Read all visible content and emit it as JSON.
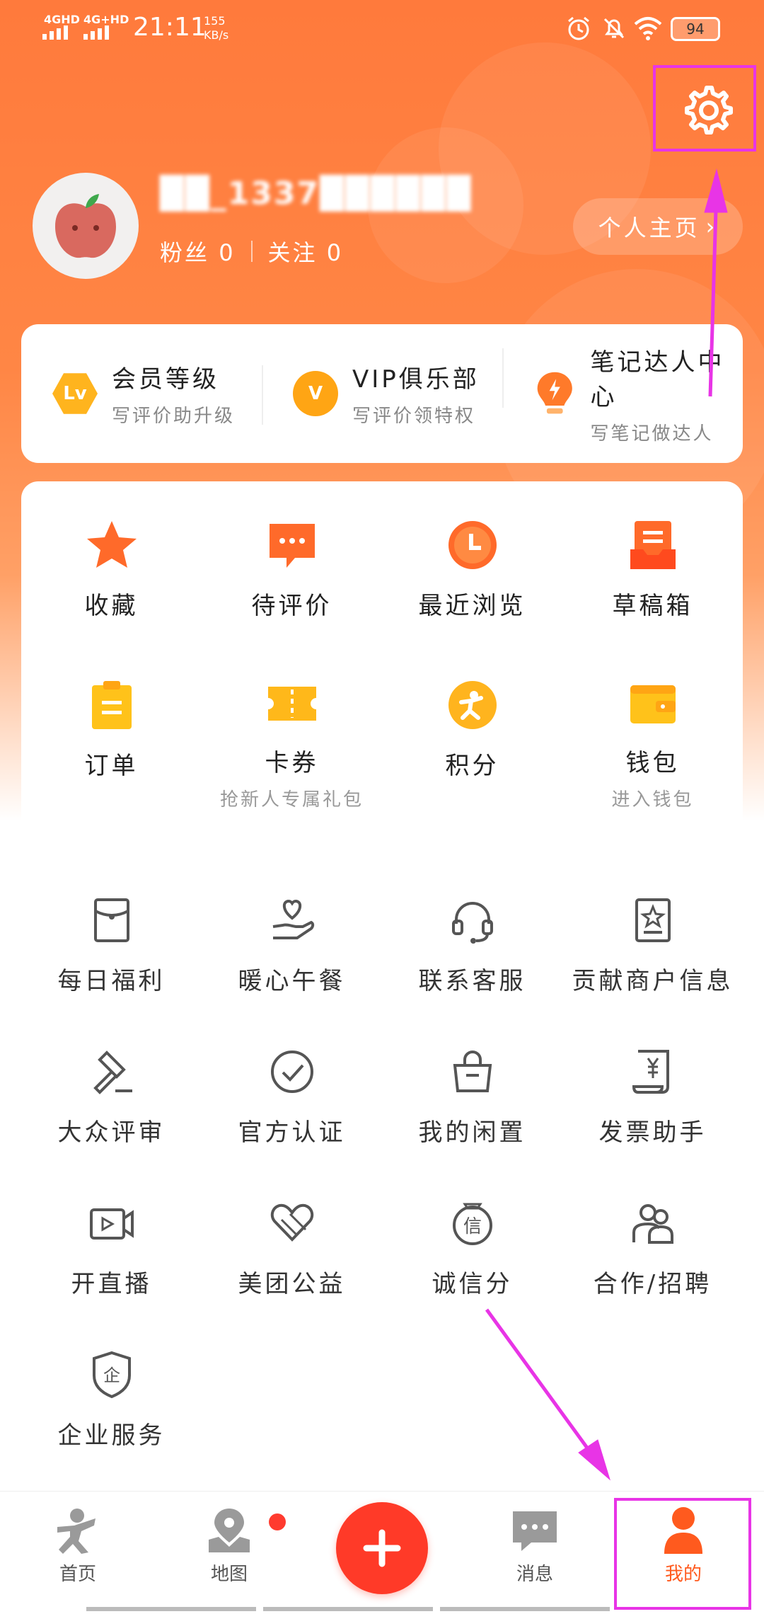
{
  "status_bar": {
    "network1": "4GHD",
    "network2": "4G+HD",
    "time": "21:11",
    "speed_value": "155",
    "speed_unit": "KB/s",
    "battery": "94"
  },
  "profile": {
    "username": "██_1337██████",
    "fans_label": "粉丝",
    "fans_count": "0",
    "follow_label": "关注",
    "follow_count": "0",
    "homepage_label": "个人主页"
  },
  "member": [
    {
      "badge": "Lv",
      "title": "会员等级",
      "subtitle": "写评价助升级"
    },
    {
      "badge": "V",
      "title": "VIP俱乐部",
      "subtitle": "写评价领特权"
    },
    {
      "badge": "",
      "title": "笔记达人中心",
      "subtitle": "写笔记做达人"
    }
  ],
  "quick": [
    {
      "icon": "star-icon",
      "label": "收藏",
      "sub": ""
    },
    {
      "icon": "chat-icon",
      "label": "待评价",
      "sub": ""
    },
    {
      "icon": "clock-icon",
      "label": "最近浏览",
      "sub": ""
    },
    {
      "icon": "draft-box-icon",
      "label": "草稿箱",
      "sub": ""
    },
    {
      "icon": "order-icon",
      "label": "订单",
      "sub": ""
    },
    {
      "icon": "ticket-icon",
      "label": "卡券",
      "sub": "抢新人专属礼包"
    },
    {
      "icon": "points-icon",
      "label": "积分",
      "sub": ""
    },
    {
      "icon": "wallet-icon",
      "label": "钱包",
      "sub": "进入钱包"
    }
  ],
  "services": [
    {
      "icon": "red-envelope-icon",
      "label": "每日福利"
    },
    {
      "icon": "heart-hand-icon",
      "label": "暖心午餐"
    },
    {
      "icon": "headset-icon",
      "label": "联系客服"
    },
    {
      "icon": "merchant-info-icon",
      "label": "贡献商户信息"
    },
    {
      "icon": "gavel-icon",
      "label": "大众评审"
    },
    {
      "icon": "verified-icon",
      "label": "官方认证"
    },
    {
      "icon": "bag-icon",
      "label": "我的闲置"
    },
    {
      "icon": "invoice-icon",
      "label": "发票助手"
    },
    {
      "icon": "live-video-icon",
      "label": "开直播"
    },
    {
      "icon": "charity-icon",
      "label": "美团公益"
    },
    {
      "icon": "credit-icon",
      "label": "诚信分"
    },
    {
      "icon": "recruit-icon",
      "label": "合作/招聘"
    },
    {
      "icon": "enterprise-icon",
      "label": "企业服务"
    }
  ],
  "nav": {
    "home": "首页",
    "map": "地图",
    "messages": "消息",
    "mine": "我的"
  },
  "colors": {
    "brand_orange": "#ff7a3c",
    "accent_red": "#ff3a28",
    "annotation_magenta": "#e834e6"
  }
}
